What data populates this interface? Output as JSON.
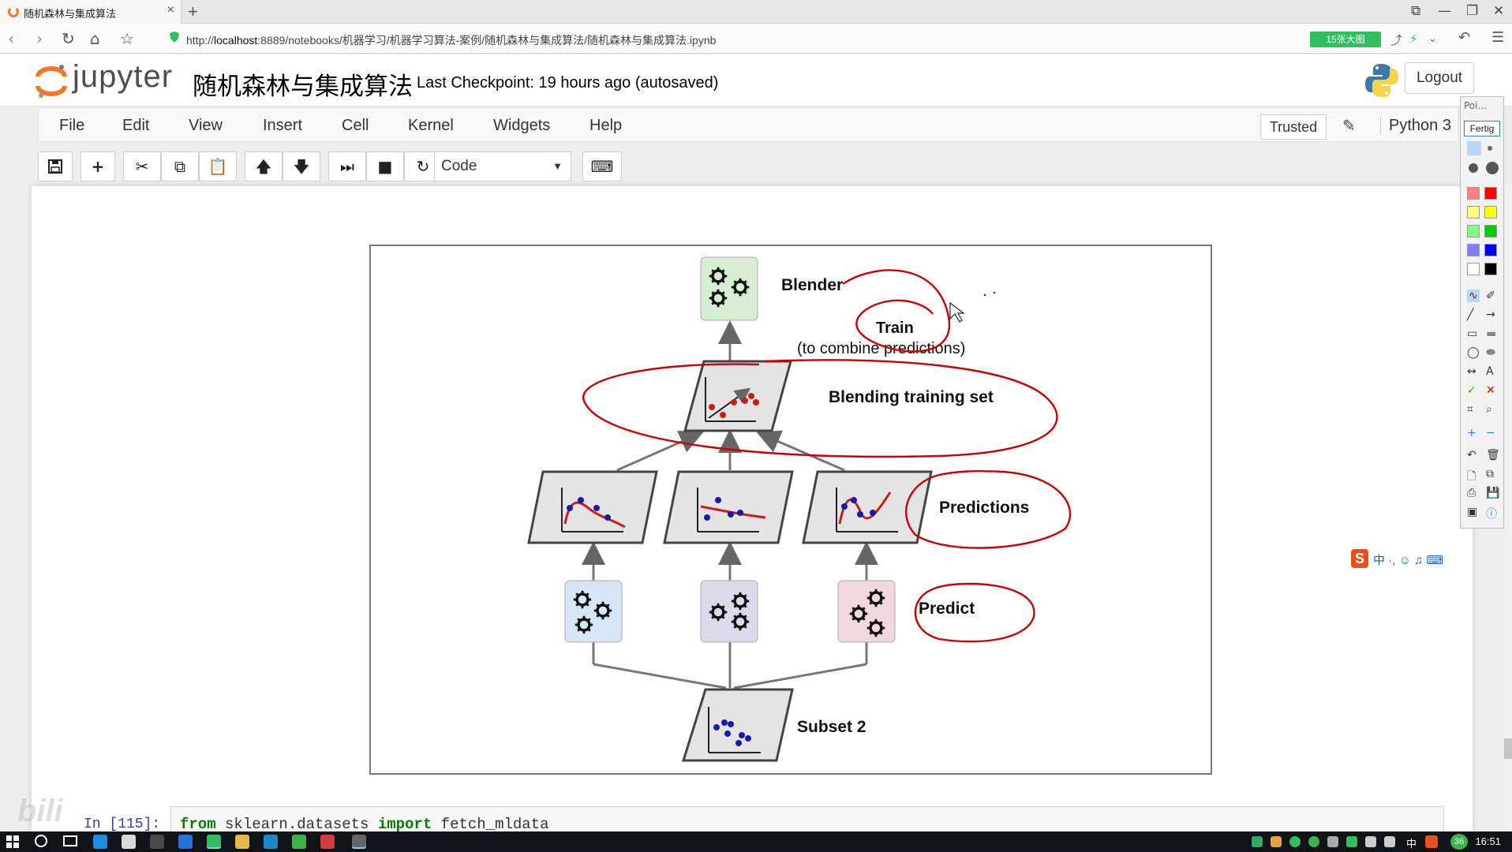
{
  "browser": {
    "tab_title": "随机森林与集成算法",
    "tab_close": "×",
    "new_tab": "+",
    "url_prefix": "http://",
    "url_host": "localhost",
    "url_rest": ":8889/notebooks/机器学习/机器学习算法-案例/随机森林与集成算法/随机森林与集成算法.ipynb",
    "badge_text": "15张大图",
    "window_controls": [
      "⧉",
      "—",
      "❐",
      "✕"
    ]
  },
  "jupyter": {
    "logo_text": "jupyter",
    "notebook_title": "随机森林与集成算法",
    "checkpoint": "Last Checkpoint: 19 hours ago (autosaved)",
    "logout_label": "Logout",
    "menu": [
      "File",
      "Edit",
      "View",
      "Insert",
      "Cell",
      "Kernel",
      "Widgets",
      "Help"
    ],
    "trusted_label": "Trusted",
    "kernel_name": "Python 3",
    "cell_type": "Code"
  },
  "figure": {
    "blender_label": "Blender",
    "train_label": "Train",
    "train_sub": "(to combine predictions)",
    "blending_label": "Blending training set",
    "predictions_label": "Predictions",
    "predict_label": "Predict",
    "subset_label": "Subset 2",
    "colors": {
      "annotation": "#cc0000",
      "blender_box": "#d8ecd3",
      "pred1_box": "#d6e6f6",
      "pred2_box": "#ddd9ec",
      "pred3_box": "#f1d8df",
      "panel_fill": "#e4e4e4",
      "dot_blue": "#1a1aa6",
      "dot_red": "#cc1a1a"
    }
  },
  "next_cell": {
    "prompt": "In [115]:",
    "code_keyword1": "from",
    "code_module": " sklearn.datasets ",
    "code_keyword2": "import",
    "code_name": " fetch_mldata"
  },
  "palette": {
    "title": "Poi...",
    "done_button": "Fertig",
    "swatches": [
      "#ff8080",
      "#ff0000",
      "#ffff80",
      "#ffff00",
      "#80ff80",
      "#00cc00",
      "#8080ff",
      "#0000ff",
      "#ffffff",
      "#000000"
    ]
  },
  "ime_bar": {
    "logo": "S",
    "text": "中 ·, ☺ ♫ ⌨"
  },
  "taskbar": {
    "ime": "中",
    "notifications": "36",
    "clock": "16:51"
  },
  "watermark": "bili"
}
